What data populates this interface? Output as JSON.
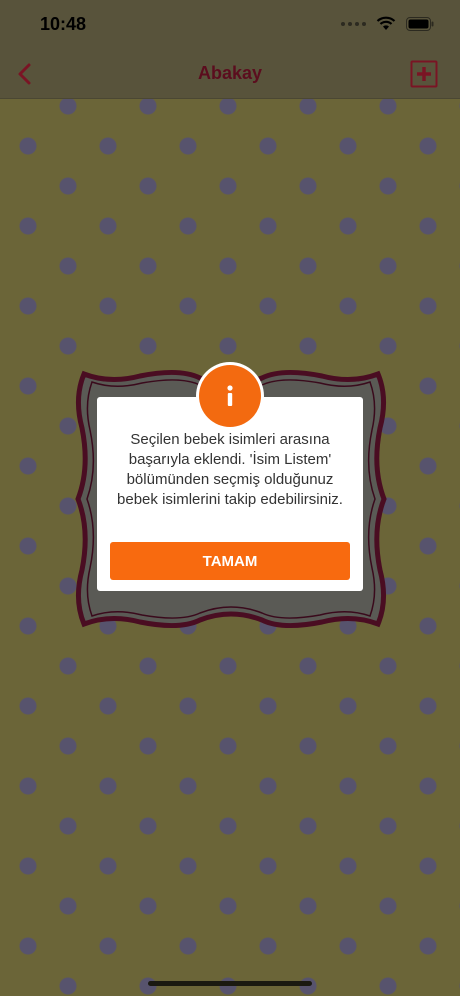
{
  "status_bar": {
    "time": "10:48"
  },
  "nav": {
    "title": "Abakay",
    "back_icon": "chevron-left-icon",
    "add_icon": "plus-square-icon"
  },
  "dialog": {
    "icon": "info-icon",
    "icon_glyph": "i",
    "message": "Seçilen bebek isimleri arasına başarıyla eklendi. 'İsim Listem' bölümünden seçmiş olduğunuz bebek isimlerini takip edebilirsiniz.",
    "ok_label": "TAMAM"
  },
  "colors": {
    "accent": "#F86A0F",
    "title": "#5B0D1E",
    "background": "#6B6538",
    "dots": "#57536D"
  }
}
